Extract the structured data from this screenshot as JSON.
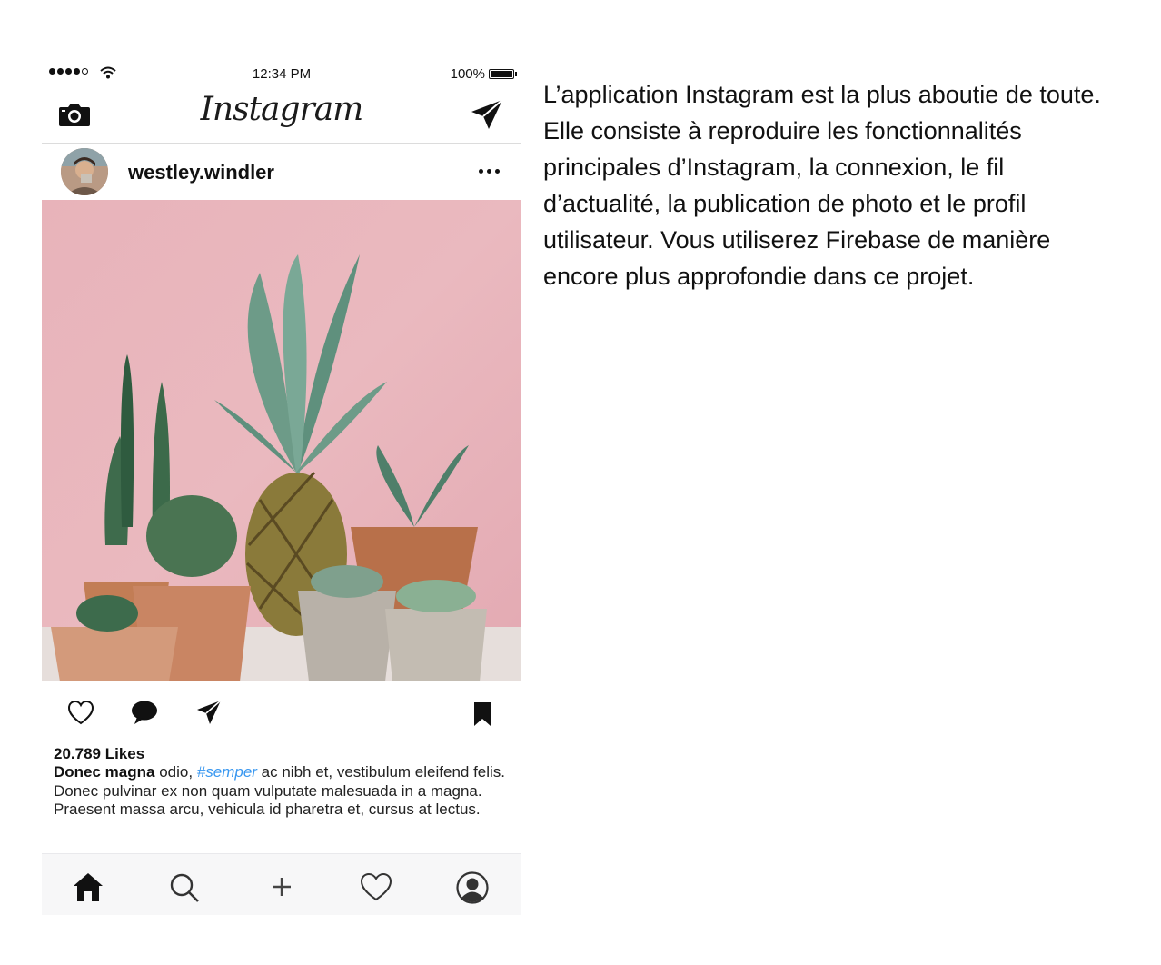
{
  "status_bar": {
    "time": "12:34 PM",
    "battery": "100%"
  },
  "app": {
    "logo": "Instagram"
  },
  "icons": {
    "camera": "camera-icon",
    "direct": "paper-plane-icon",
    "like": "heart-icon",
    "comment": "speech-bubble-icon",
    "share": "paper-plane-icon",
    "save": "bookmark-icon",
    "home": "home-icon",
    "search": "magnifier-icon",
    "add": "plus-icon",
    "activity": "heart-icon",
    "profile": "user-icon"
  },
  "post": {
    "username": "westley.windler",
    "likes": "20.789 Likes",
    "caption": {
      "user": "Donec magna",
      "text_before": " odio, ",
      "hashtag": "#semper",
      "text_after": " ac nibh et, vestibulum eleifend felis. Donec pulvinar ex non quam vulputate malesuada in a magna. Praesent massa arcu, vehicula id pharetra et, cursus at lectus."
    }
  },
  "description": "L’application Instagram est la plus aboutie de toute. Elle consiste à reproduire les fonctionnalités principales d’Instagram, la connexion, le fil d’actualité, la publication de photo et le profil utilisateur. Vous utiliserez Firebase de manière encore plus approfondie dans ce projet.",
  "colors": {
    "hashtag": "#3897f0",
    "tab_bar": "#f7f7f8",
    "photo_background": "#e9b8bd"
  }
}
